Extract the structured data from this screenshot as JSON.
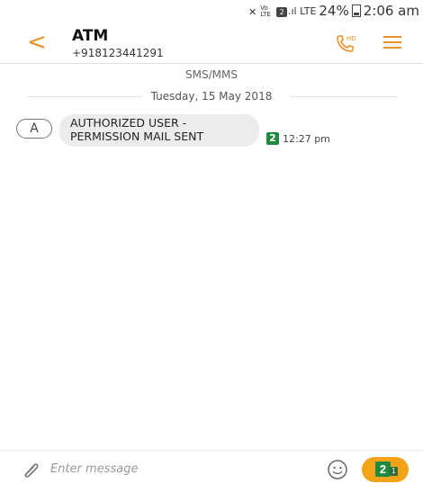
{
  "status_bar": {
    "network_text": "Vo LTE",
    "sim_badge": "2",
    "signal_text": ".ıl LTE",
    "battery_percent": "24%",
    "time": "2:06 am"
  },
  "header": {
    "back_icon": "chevron-left-icon",
    "contact_name": "ATM",
    "contact_number": "+918123441291",
    "call_icon": "hd-call-icon",
    "menu_icon": "hamburger-menu-icon"
  },
  "conversation": {
    "section_label": "SMS/MMS",
    "date_label": "Tuesday, 15 May 2018",
    "messages": [
      {
        "avatar_letter": "A",
        "lines": [
          "AUTHORIZED USER -",
          "PERMISSION MAIL SENT"
        ],
        "sim_badge": "2",
        "time": "12:27 pm"
      }
    ]
  },
  "composer": {
    "placeholder": "Enter message",
    "attach_icon": "paperclip-icon",
    "emoji_icon": "smiley-icon",
    "send_sim_badge": "2",
    "send_count": "1"
  },
  "colors": {
    "accent": "#e8902a",
    "send_button": "#f3a31a",
    "sim_green": "#1f8a3d",
    "bubble": "#ececec"
  }
}
